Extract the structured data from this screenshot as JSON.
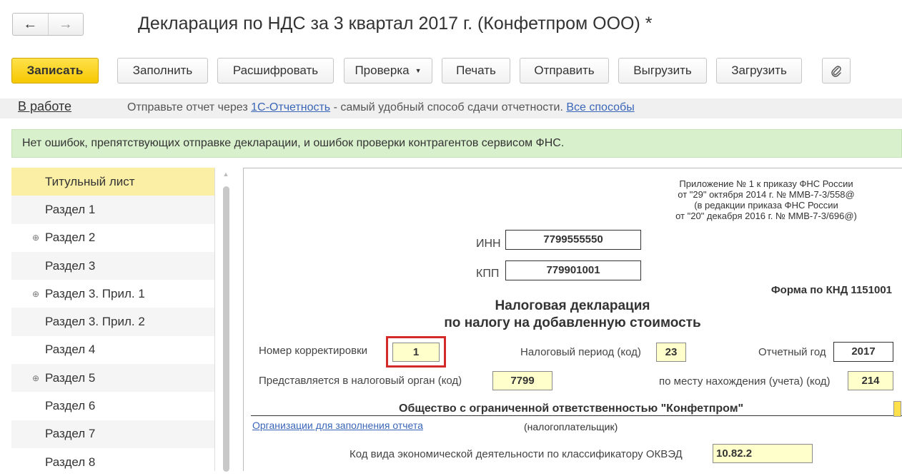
{
  "nav": {
    "back": "←",
    "forward": "→"
  },
  "title": "Декларация по НДС за 3 квартал 2017 г. (Конфетпром ООО) *",
  "toolbar": {
    "save": "Записать",
    "fill": "Заполнить",
    "decode": "Расшифровать",
    "check": "Проверка",
    "print": "Печать",
    "send": "Отправить",
    "export": "Выгрузить",
    "import": "Загрузить",
    "attach_icon": "paperclip-icon"
  },
  "status": {
    "state": "В работе",
    "hint_prefix": "Отправьте отчет через",
    "hint_link": "1С-Отчетность",
    "hint_middle": "- самый удобный способ сдачи отчетности.",
    "hint_all": "Все способы"
  },
  "banner": "Нет ошибок, препятствующих отправке декларации, и ошибок проверки контрагентов сервисом ФНС.",
  "sidebar": {
    "items": [
      {
        "label": "Титульный лист",
        "expand": ""
      },
      {
        "label": "Раздел 1",
        "expand": ""
      },
      {
        "label": "Раздел 2",
        "expand": "⊕"
      },
      {
        "label": "Раздел 3",
        "expand": ""
      },
      {
        "label": "Раздел 3. Прил. 1",
        "expand": "⊕"
      },
      {
        "label": "Раздел 3. Прил. 2",
        "expand": ""
      },
      {
        "label": "Раздел 4",
        "expand": ""
      },
      {
        "label": "Раздел 5",
        "expand": "⊕"
      },
      {
        "label": "Раздел 6",
        "expand": ""
      },
      {
        "label": "Раздел 7",
        "expand": ""
      },
      {
        "label": "Раздел 8",
        "expand": ""
      }
    ]
  },
  "doc": {
    "note1": "Приложение № 1 к приказу ФНС России",
    "note2": "от \"29\" октября 2014 г. № ММВ-7-3/558@",
    "note3": "(в редакции приказа ФНС России",
    "note4": "от \"20\" декабря 2016 г. № ММВ-7-3/696@)",
    "inn_label": "ИНН",
    "inn": "7799555550",
    "kpp_label": "КПП",
    "kpp": "779901001",
    "form": "Форма по КНД 1151001",
    "heading1": "Налоговая декларация",
    "heading2": "по налогу на добавленную стоимость",
    "correction_label": "Номер корректировки",
    "correction": "1",
    "period_label": "Налоговый период (код)",
    "period": "23",
    "year_label": "Отчетный год",
    "year": "2017",
    "authority_label": "Представляется в налоговый орган (код)",
    "authority": "7799",
    "location_label": "по месту нахождения (учета) (код)",
    "location": "214",
    "company": "Общество с ограниченной ответственностью \"Конфетпром\"",
    "org_link": "Организации для заполнения отчета",
    "taxpayer": "(налогоплательщик)",
    "okved_label": "Код вида экономической деятельности по классификатору ОКВЭД",
    "okved": "10.82.2"
  }
}
